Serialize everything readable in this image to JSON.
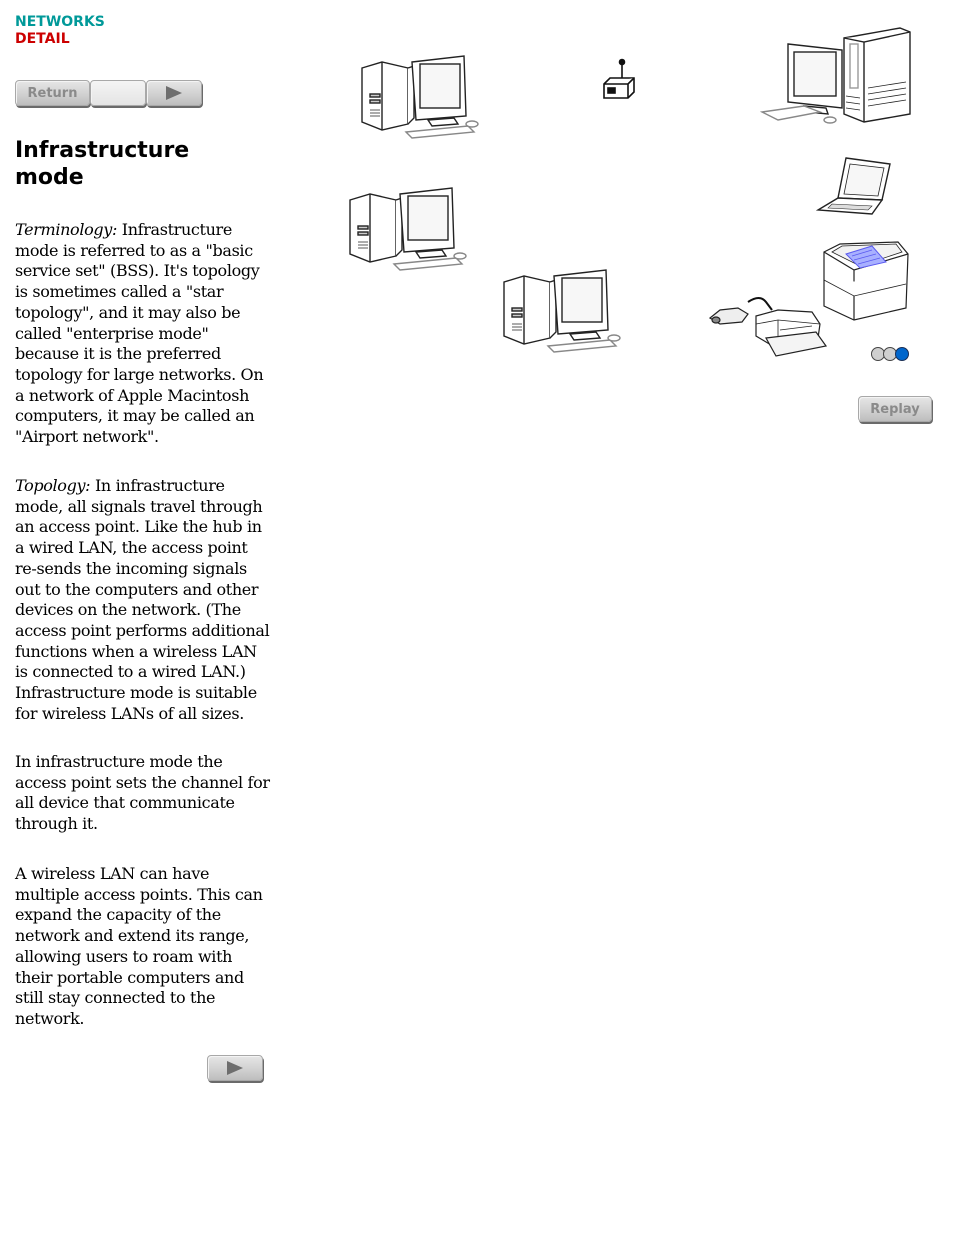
{
  "header": {
    "section": "NETWORKS",
    "subsection": "DETAIL",
    "section_color": "#009999",
    "subsection_color": "#cc0000"
  },
  "nav": {
    "return_label": "Return",
    "next_icon": "play-triangle-icon"
  },
  "title": "Infrastructure mode",
  "paragraphs": [
    {
      "lead": "Terminology:",
      "text": " Infrastructure mode is referred to as a \"basic service set\" (BSS). It's topology is sometimes called a \"star topology\", and it may also be called \"enterprise mode\" because it is the preferred topology for large networks. On a network of Apple Macintosh computers, it may be called an \"Airport network\"."
    },
    {
      "lead": "Topology:",
      "text": " In infrastructure mode, all signals travel through an access point. Like the hub in a wired LAN, the access point re-sends the incoming signals out to the computers and other devices on the network. (The access point performs additional functions when a wireless LAN is connected to a wired LAN.) Infrastructure mode is suitable for wireless LANs of all sizes."
    },
    {
      "lead": "",
      "text": "In infrastructure mode the access point sets the channel for all device that communicate through it."
    },
    {
      "lead": "",
      "text": "A wireless LAN can have multiple access points. This can expand the capacity of the network and extend its range, allowing users to roam with their portable computers and still stay connected to the network."
    }
  ],
  "diagram": {
    "devices": [
      {
        "type": "desktop-computer",
        "label": "desktop-computer-1"
      },
      {
        "type": "access-point",
        "label": "access-point"
      },
      {
        "type": "tower-computer",
        "label": "tower-computer"
      },
      {
        "type": "laptop",
        "label": "laptop"
      },
      {
        "type": "desktop-computer",
        "label": "desktop-computer-2"
      },
      {
        "type": "desktop-computer",
        "label": "desktop-computer-3"
      },
      {
        "type": "laser-printer",
        "label": "laser-printer"
      },
      {
        "type": "inkjet-printer-with-adapter",
        "label": "inkjet-printer"
      }
    ],
    "animation_steps": 3,
    "current_step": 3,
    "active_dot_color": "#0066cc",
    "inactive_dot_color": "#cfcfcf",
    "replay_label": "Replay"
  }
}
